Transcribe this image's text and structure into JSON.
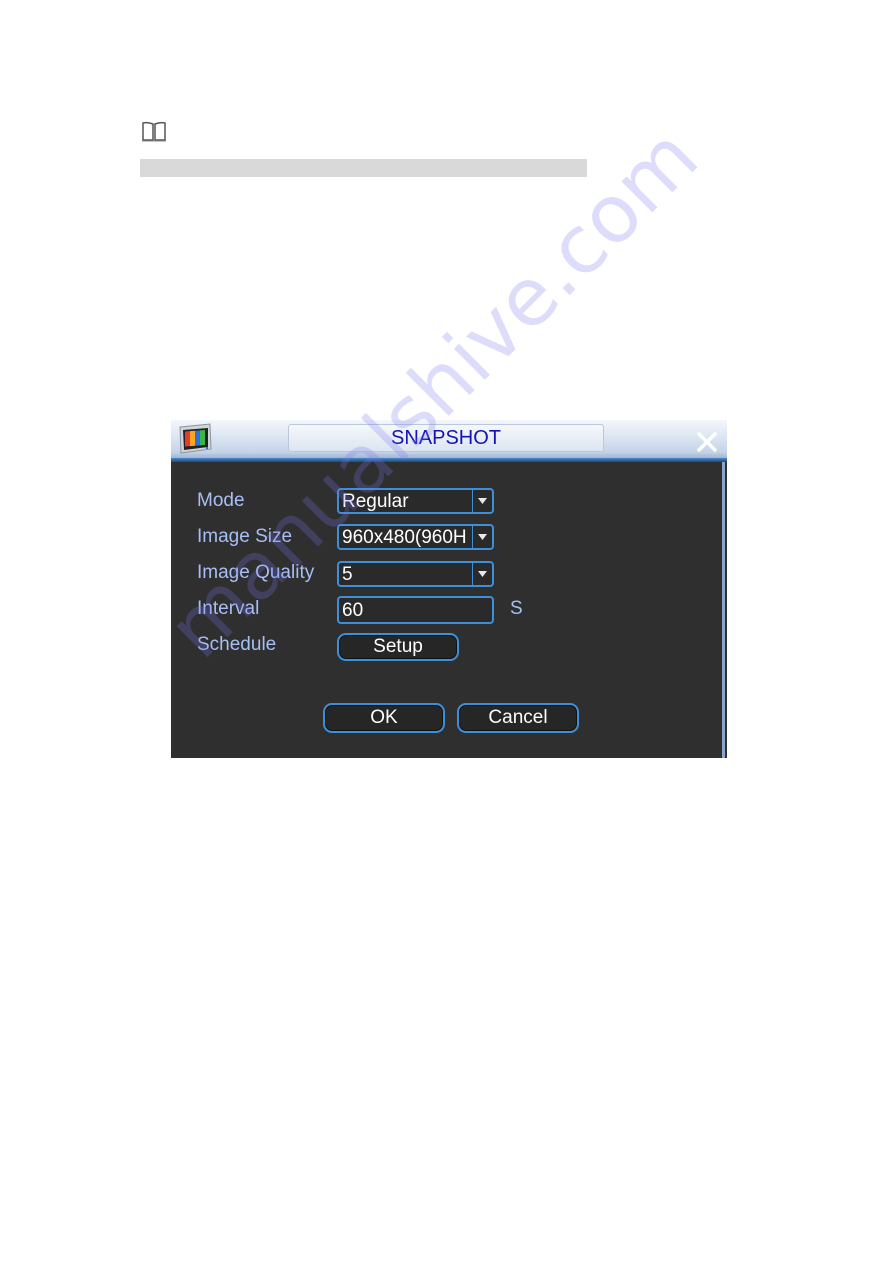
{
  "document": {
    "note_icon": "book-icon",
    "watermark_text": "manualshive.com"
  },
  "dialog": {
    "title": "SNAPSHOT",
    "app_icon": "monitor-color-bars-icon",
    "close_icon": "close-icon",
    "fields": {
      "mode": {
        "label": "Mode",
        "value": "Regular"
      },
      "image_size": {
        "label": "Image Size",
        "value": "960x480(960H"
      },
      "image_quality": {
        "label": "Image Quality",
        "value": "5"
      },
      "interval": {
        "label": "Interval",
        "value": "60",
        "unit": "S"
      },
      "schedule": {
        "label": "Schedule",
        "button": "Setup"
      }
    },
    "buttons": {
      "ok": "OK",
      "cancel": "Cancel"
    },
    "colors": {
      "title_text": "#1414b4",
      "label_text": "#a8bff5",
      "field_border": "#3e8fd8",
      "panel_bg": "#2f2f2f"
    }
  }
}
